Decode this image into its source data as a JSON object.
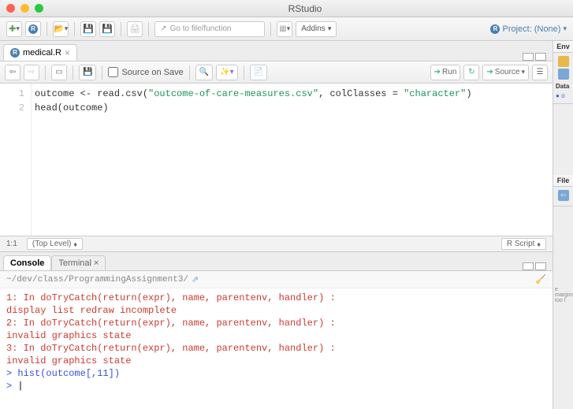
{
  "window": {
    "title": "RStudio"
  },
  "toolbar": {
    "goto_placeholder": "Go to file/function",
    "addins_label": "Addins"
  },
  "project": {
    "label": "Project: (None)"
  },
  "editor": {
    "tab_name": "medical.R",
    "source_on_save": "Source on Save",
    "run": "Run",
    "source": "Source",
    "lines": {
      "l1": "1",
      "l2": "2"
    },
    "code1a": "outcome <- read.csv(",
    "code1b": "\"outcome-of-care-measures.csv\"",
    "code1c": ", colClasses = ",
    "code1d": "\"character\"",
    "code1e": ")",
    "code2": "head(outcome)"
  },
  "statusbar": {
    "pos": "1:1",
    "scope": "(Top Level)",
    "type": "R Script"
  },
  "console": {
    "tab_console": "Console",
    "tab_terminal": "Terminal",
    "path": "~/dev/class/ProgrammingAssignment3/",
    "e1": "1: In doTryCatch(return(expr), name, parentenv, handler) :",
    "e1b": "  display list redraw incomplete",
    "e2": "2: In doTryCatch(return(expr), name, parentenv, handler) :",
    "e2b": "  invalid graphics state",
    "e3": "3: In doTryCatch(return(expr), name, parentenv, handler) :",
    "e3b": "  invalid graphics state",
    "cmd1": "hist(outcome[,11])",
    "prompt": ">"
  },
  "right": {
    "env": "Env",
    "data": "Data",
    "o": "o",
    "file": "File",
    "margins": "e margins too l"
  }
}
